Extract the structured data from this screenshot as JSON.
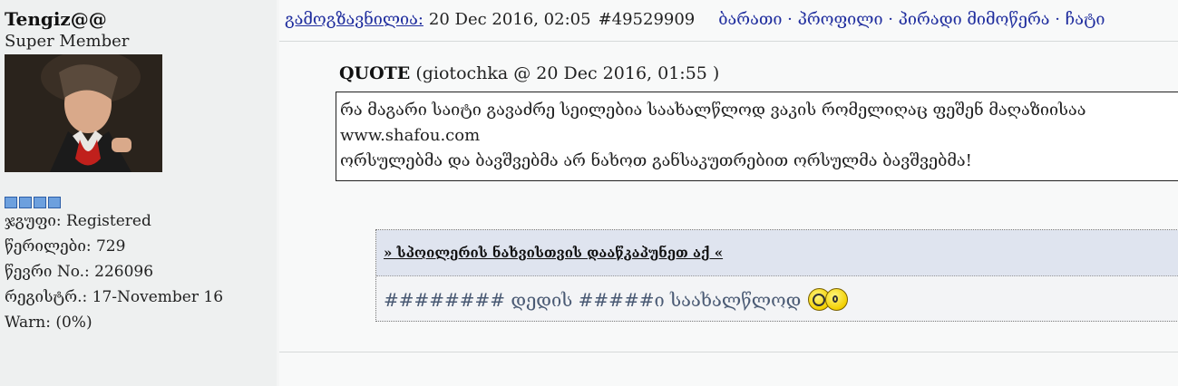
{
  "user": {
    "name": "Tengiz@@",
    "title": "Super Member",
    "group_label": "ჯგუფი:",
    "group_value": "Registered",
    "posts_label": "წერილები:",
    "posts_value": "729",
    "member_no_label": "წევრი No.:",
    "member_no_value": "226096",
    "registered_label": "რეგისტრ.:",
    "registered_value": "17-November 16",
    "warn_label": "Warn:",
    "warn_value": "(0%)",
    "rank_pips": 4
  },
  "post": {
    "posted_label": "გამოგზავნილია:",
    "date": "20 Dec 2016, 02:05",
    "post_number": "#49529909",
    "nav": "ბარათი · პროფილი · პირადი მიმოწერა · ჩატი"
  },
  "quote": {
    "label": "QUOTE",
    "meta": "(giotochka @ 20 Dec 2016, 01:55 )",
    "lines": [
      "რა მაგარი საიტი გავაძრე სეილებია საახალწლოდ ვაკის რომელიღაც ფეშენ მაღაზიისაა",
      "www.shafou.com",
      "ორსულებმა და ბავშვებმა არ ნახოთ განსაკუთრებით ორსულმა ბავშვებმა!"
    ]
  },
  "spoiler": {
    "title": "» სპოილერის ნახვისთვის დააწკაპუნეთ აქ «",
    "body": "######## დედის #####ი საახალწლოდ"
  },
  "colors": {
    "link": "#1f2d9e",
    "sidebar_bg": "#eef0f0",
    "pip": "#6da0de",
    "spoiler_header_bg": "#dfe4ef",
    "spoiler_text": "#4a5a74"
  }
}
